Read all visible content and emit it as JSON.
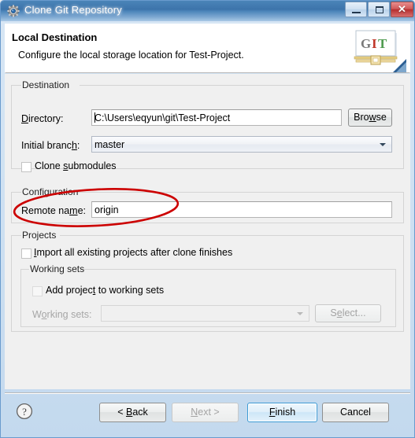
{
  "window": {
    "title": "Clone Git Repository",
    "icon": "git-repository-gear-icon",
    "buttons": {
      "minimize": "minimize-icon",
      "maximize": "maximize-icon",
      "close": "✕"
    }
  },
  "header": {
    "title": "Local Destination",
    "description": "Configure the local storage location for Test-Project.",
    "logo_text": [
      "G",
      "I",
      "T"
    ],
    "logo_colors": [
      "#7a7a7a",
      "#c0392b",
      "#4f9b4f"
    ]
  },
  "destination": {
    "group_label": "Destination",
    "directory": {
      "label": "Directory:",
      "label_mnemonic": "D",
      "value": "C:\\Users\\eqyun\\git\\Test-Project"
    },
    "browse_button": "Browse",
    "browse_mnemonic": "w",
    "initial_branch": {
      "label": "Initial branch:",
      "label_mnemonic": "h",
      "value": "master"
    },
    "clone_submodules": {
      "label": "Clone submodules",
      "label_mnemonic": "s",
      "checked": false
    }
  },
  "configuration": {
    "group_label": "Configuration",
    "remote_name": {
      "label": "Remote name:",
      "label_mnemonic": "m",
      "value": "origin"
    }
  },
  "projects": {
    "group_label": "Projects",
    "import_all": {
      "label": "Import all existing projects after clone finishes",
      "label_mnemonic": "I",
      "checked": false
    },
    "working_sets_group_label": "Working sets",
    "add_to_working_sets": {
      "label": "Add project to working sets",
      "label_mnemonic": "t",
      "checked": false,
      "enabled": false
    },
    "working_sets": {
      "label": "Working sets:",
      "label_mnemonic": "o",
      "value": "",
      "enabled": false
    },
    "select_button": {
      "label": "Select...",
      "mnemonic": "e",
      "enabled": false
    }
  },
  "footer": {
    "help_icon": "help-question-icon",
    "back_button": {
      "label": "< Back",
      "mnemonic": "B",
      "enabled": true
    },
    "next_button": {
      "label": "Next >",
      "mnemonic": "N",
      "enabled": false
    },
    "finish_button": {
      "label": "Finish",
      "mnemonic": "F",
      "enabled": true,
      "is_default": true
    },
    "cancel_button": {
      "label": "Cancel",
      "enabled": true
    }
  },
  "annotation": {
    "shape": "red-ellipse-highlight",
    "color": "#cc0000",
    "target": "remote-name-row"
  }
}
